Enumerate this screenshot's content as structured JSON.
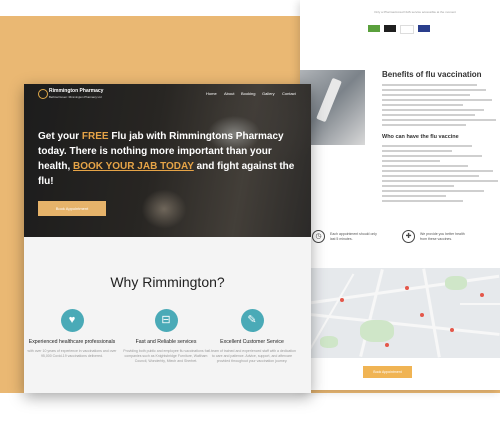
{
  "colors": {
    "background_band": "#eab873",
    "accent": "#e6a447",
    "teal": "#4aaab7",
    "book_button": "#f0b454"
  },
  "front": {
    "brand": {
      "name": "Rimmington Pharmacy",
      "tagline": "Bethnal Green: Rimmington Pharmacy Ltd"
    },
    "nav": [
      "Home",
      "About",
      "Booking",
      "Gallery",
      "Contact"
    ],
    "hero": {
      "line1_pre": "Get your ",
      "line1_hl": "FREE",
      "line1_post": " Flu jab with Rimmingtons Pharmacy today. There is nothing more important than your health, ",
      "link": "BOOK YOUR JAB TODAY",
      "tail": " and fight against the flu!",
      "cta": "Book Appointment"
    },
    "why": {
      "title": "Why Rimmington?",
      "cards": [
        {
          "icon": "heart-pulse-icon",
          "glyph": "♥",
          "title": "Experienced healthcare professionals",
          "desc": "with over 10 years of experience in vaccinations and over 95,000 Covid-19 vaccinations delivered."
        },
        {
          "icon": "pill-bottle-icon",
          "glyph": "⊟",
          "title": "Fast and Reliable services",
          "desc": "Providing both public and employee flu vaccinations for companies such as Knightsbridge Furniture, Waltham Council, Wonderbly, Mtech and Sherbet."
        },
        {
          "icon": "syringe-icon",
          "glyph": "✎",
          "title": "Excellent Customer Service",
          "desc": "A team of trained and experienced staff with a dedication to care and patience. Advice, support, and aftercare provided throughout your vaccination journey."
        }
      ]
    }
  },
  "back": {
    "top_text": "Only a Pharmacist-led NHS service accessible at the moment",
    "benefits_title": "Benefits of flu vaccination",
    "who_title": "Who can have the flu vaccine",
    "feature1": "Each appointment should only last 5 minutes.",
    "feature2": "We provide you better health from these vaccines.",
    "book_button": "Book Appointment"
  }
}
